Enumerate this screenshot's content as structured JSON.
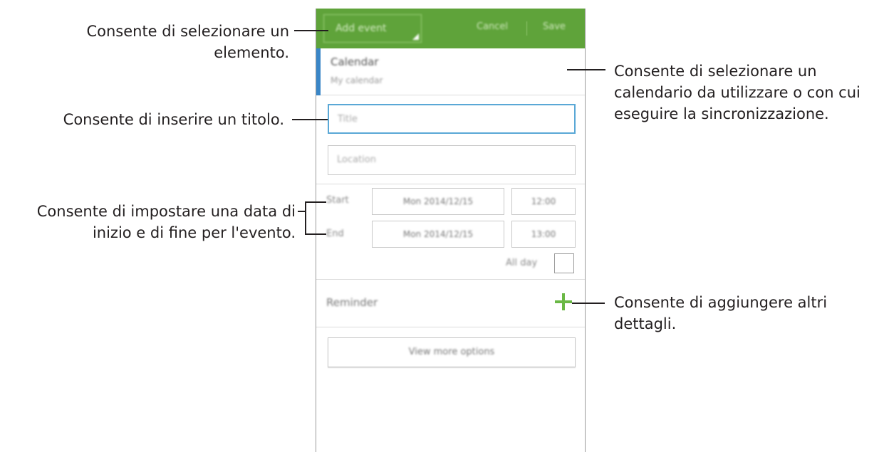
{
  "appbar": {
    "add_event_label": "Add event",
    "cancel_label": "Cancel",
    "save_label": "Save",
    "accent_color": "#5fa33a"
  },
  "calendar": {
    "label": "Calendar",
    "value": "My calendar",
    "indicator_color": "#3a86c7"
  },
  "fields": {
    "title_placeholder": "Title",
    "location_placeholder": "Location"
  },
  "schedule": {
    "start_label": "Start",
    "start_date": "Mon 2014/12/15",
    "start_time": "12:00",
    "end_label": "End",
    "end_date": "Mon 2014/12/15",
    "end_time": "13:00",
    "all_day_label": "All day"
  },
  "reminder": {
    "label": "Reminder",
    "add_icon": "plus-icon"
  },
  "more_options_label": "View more options",
  "callouts": {
    "select_item": [
      "Consente di selezionare un",
      "elemento."
    ],
    "enter_title": [
      "Consente di inserire un titolo."
    ],
    "set_dates": [
      "Consente di impostare una data di",
      "inizio e di fine per l'evento."
    ],
    "select_calendar": [
      "Consente di selezionare un",
      "calendario da utilizzare o con cui",
      "eseguire la sincronizzazione."
    ],
    "add_details": [
      "Consente di aggiungere altri",
      "dettagli."
    ]
  }
}
